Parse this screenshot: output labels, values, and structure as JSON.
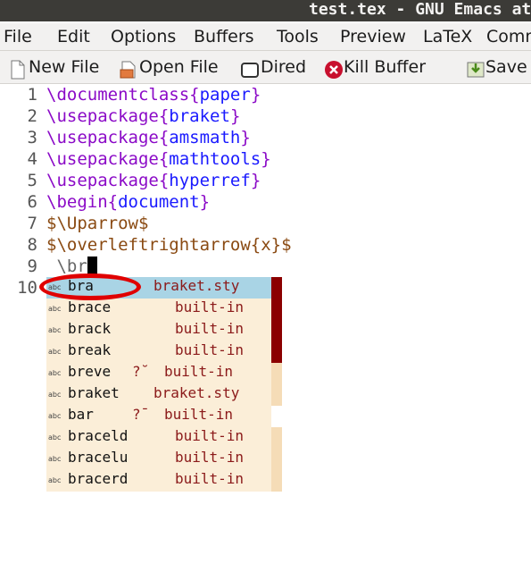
{
  "window": {
    "title": "test.tex - GNU Emacs at"
  },
  "menubar": {
    "items": [
      "File",
      "Edit",
      "Options",
      "Buffers",
      "Tools",
      "Preview",
      "LaTeX",
      "Comma"
    ]
  },
  "toolbar": {
    "new_file": "New File",
    "open_file": "Open File",
    "dired": "Dired",
    "kill_buffer": "Kill Buffer",
    "save": "Save"
  },
  "editor": {
    "lines": [
      {
        "num": "1",
        "cmd": "\\documentclass",
        "open": "{",
        "arg": "paper",
        "close": "}"
      },
      {
        "num": "2",
        "cmd": "\\usepackage",
        "open": "{",
        "arg": "braket",
        "close": "}"
      },
      {
        "num": "3",
        "cmd": "\\usepackage",
        "open": "{",
        "arg": "amsmath",
        "close": "}"
      },
      {
        "num": "4",
        "cmd": "\\usepackage",
        "open": "{",
        "arg": "mathtools",
        "close": "}"
      },
      {
        "num": "5",
        "cmd": "\\usepackage",
        "open": "{",
        "arg": "hyperref",
        "close": "}"
      },
      {
        "num": "6",
        "cmd": "\\begin",
        "open": "{",
        "arg": "document",
        "close": "}"
      },
      {
        "num": "7",
        "text": "$\\Uparrow$"
      },
      {
        "num": "8",
        "text": "$\\overleftrightarrow{x}$"
      },
      {
        "num": "9",
        "text": " \\br"
      },
      {
        "num": "10",
        "text": ""
      }
    ]
  },
  "completion": {
    "type_badge": "abc",
    "items": [
      {
        "label": "bra",
        "annotation": "",
        "source": "braket.sty",
        "selected": true
      },
      {
        "label": "brace",
        "annotation": "",
        "source": "built-in",
        "selected": false
      },
      {
        "label": "brack",
        "annotation": "",
        "source": "built-in",
        "selected": false
      },
      {
        "label": "break",
        "annotation": "",
        "source": "built-in",
        "selected": false
      },
      {
        "label": "breve",
        "annotation": "?̆",
        "source": "built-in",
        "selected": false
      },
      {
        "label": "braket",
        "annotation": "",
        "source": "braket.sty",
        "selected": false
      },
      {
        "label": "bar",
        "annotation": "?̄",
        "source": "built-in",
        "selected": false
      },
      {
        "label": "braceld",
        "annotation": "",
        "source": "built-in",
        "selected": false
      },
      {
        "label": "bracelu",
        "annotation": "",
        "source": "built-in",
        "selected": false
      },
      {
        "label": "bracerd",
        "annotation": "",
        "source": "built-in",
        "selected": false
      }
    ]
  },
  "colors": {
    "command": "#8b0ac7",
    "argument": "#1a1aff",
    "math": "#8a4a12",
    "selection": "#a9d4e5",
    "popup": "#fbeed8",
    "highlight_ring": "#e00000"
  }
}
